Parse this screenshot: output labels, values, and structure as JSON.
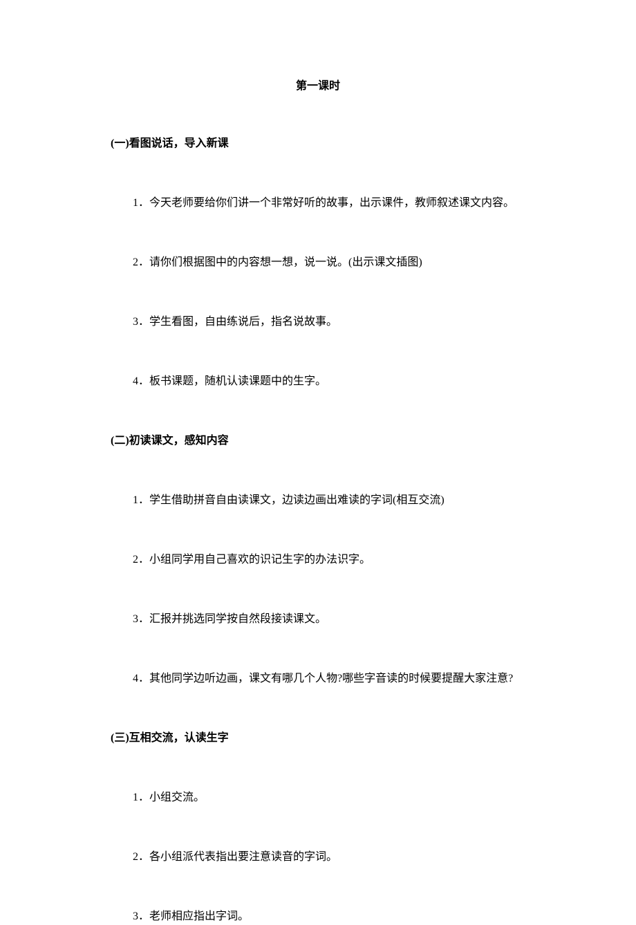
{
  "title": "第一课时",
  "section1": {
    "heading": "(一)看图说话，导入新课",
    "items": [
      "1．今天老师要给你们讲一个非常好听的故事，出示课件，教师叙述课文内容。",
      "2．请你们根据图中的内容想一想，说一说。(出示课文插图)",
      "3．学生看图，自由练说后，指名说故事。",
      "4．板书课题，随机认读课题中的生字。"
    ]
  },
  "section2": {
    "heading": "(二)初读课文，感知内容",
    "items": [
      "1．学生借助拼音自由读课文，边读边画出难读的字词(相互交流)",
      "2．小组同学用自己喜欢的识记生字的办法识字。",
      "3．汇报并挑选同学按自然段接读课文。",
      "4．其他同学边听边画，课文有哪几个人物?哪些字音读的时候要提醒大家注意?"
    ]
  },
  "section3": {
    "heading": "(三)互相交流，认读生字",
    "items": [
      "1．小组交流。",
      "2．各小组派代表指出要注意读音的字词。",
      "3．老师相应指出字词。"
    ]
  }
}
